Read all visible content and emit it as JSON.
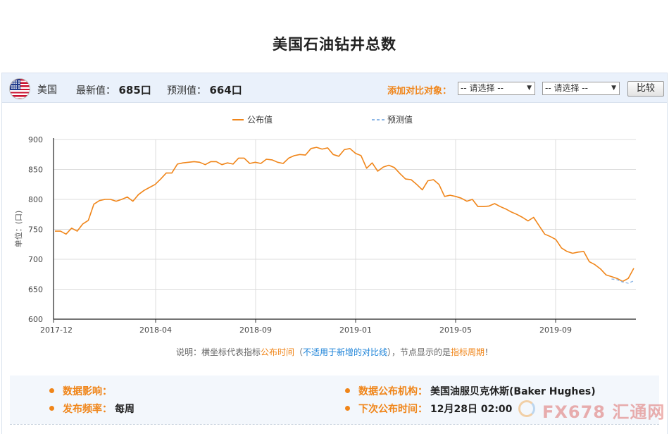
{
  "page": {
    "title": "美国石油钻井总数"
  },
  "toolbar": {
    "country": "美国",
    "latest_label": "最新值：",
    "latest_value": "685口",
    "forecast_label": "预测值：",
    "forecast_value": "664口",
    "compare_label": "添加对比对象：",
    "select1": "-- 请选择 --",
    "select2": "-- 请选择 --",
    "compare_button": "比较"
  },
  "chart_data": {
    "type": "line",
    "title": "",
    "xlabel": "",
    "ylabel": "单位：(口)",
    "ylim": [
      600,
      900
    ],
    "yticks": [
      900,
      850,
      800,
      750,
      700,
      650,
      600
    ],
    "xticks": [
      "2017-12",
      "2018-04",
      "2018-09",
      "2019-01",
      "2019-05",
      "2019-09"
    ],
    "grid": true,
    "legend_position": "top-center",
    "colors": {
      "published": "#f08519",
      "forecast": "#8db7e6"
    },
    "series": [
      {
        "name": "公布值",
        "style": "solid",
        "values": [
          747,
          747,
          742,
          752,
          747,
          759,
          765,
          792,
          798,
          800,
          800,
          797,
          800,
          804,
          797,
          808,
          815,
          820,
          825,
          834,
          844,
          844,
          859,
          861,
          862,
          863,
          862,
          858,
          863,
          863,
          858,
          861,
          859,
          869,
          869,
          860,
          862,
          860,
          867,
          866,
          862,
          860,
          869,
          873,
          875,
          874,
          885,
          887,
          884,
          886,
          875,
          872,
          883,
          885,
          877,
          873,
          852,
          861,
          847,
          854,
          857,
          853,
          843,
          834,
          833,
          825,
          816,
          831,
          833,
          825,
          805,
          807,
          805,
          802,
          797,
          800,
          788,
          788,
          789,
          793,
          788,
          784,
          779,
          775,
          770,
          764,
          770,
          756,
          742,
          738,
          733,
          719,
          713,
          710,
          712,
          713,
          696,
          691,
          684,
          674,
          671,
          668,
          663,
          668,
          685
        ]
      },
      {
        "name": "预测值",
        "style": "dashed",
        "values": [
          null,
          null,
          null,
          null,
          null,
          null,
          null,
          null,
          null,
          null,
          null,
          null,
          null,
          null,
          null,
          null,
          null,
          null,
          null,
          null,
          null,
          null,
          null,
          null,
          null,
          null,
          null,
          null,
          null,
          null,
          null,
          null,
          null,
          null,
          null,
          null,
          null,
          null,
          null,
          null,
          null,
          null,
          null,
          null,
          null,
          null,
          null,
          null,
          null,
          null,
          null,
          null,
          null,
          null,
          null,
          null,
          null,
          null,
          null,
          null,
          null,
          null,
          null,
          null,
          null,
          null,
          null,
          null,
          null,
          null,
          null,
          null,
          null,
          null,
          null,
          null,
          null,
          null,
          null,
          null,
          null,
          null,
          null,
          null,
          null,
          null,
          null,
          null,
          null,
          null,
          null,
          null,
          null,
          null,
          null,
          null,
          null,
          null,
          null,
          null,
          667,
          666,
          662,
          660,
          664
        ]
      }
    ]
  },
  "note": {
    "prefix": "说明：横坐标代表指标",
    "o1": "公布时间",
    "p1": "（",
    "b1": "不适用于新增的对比线",
    "p2": "），节点显示的是",
    "o2": "指标周期",
    "p3": "！"
  },
  "info": {
    "impact_label": "数据影响：",
    "impact_value": "",
    "freq_label": "发布频率：",
    "freq_value": "每周",
    "agency_label": "数据公布机构：",
    "agency_value": "美国油服贝克休斯(Baker Hughes)",
    "next_label": "下次公布时间：",
    "next_value": "12月28日 02:00"
  },
  "watermark": {
    "text": "FX678 汇通网"
  }
}
